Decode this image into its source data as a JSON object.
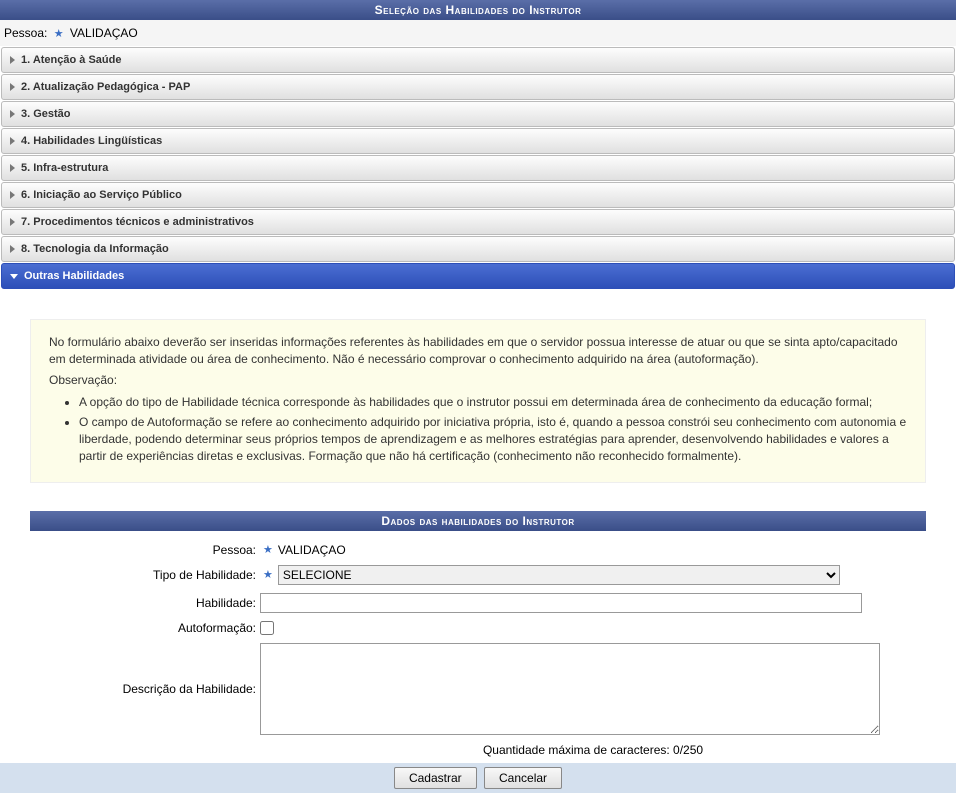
{
  "header": {
    "title": "Seleção das Habilidades do Instrutor"
  },
  "pessoa": {
    "label": "Pessoa:",
    "value": "VALIDAÇAO"
  },
  "accordion": {
    "items": [
      {
        "label": "1. Atenção à Saúde"
      },
      {
        "label": "2. Atualização Pedagógica - PAP"
      },
      {
        "label": "3. Gestão"
      },
      {
        "label": "4. Habilidades Lingüísticas"
      },
      {
        "label": "5. Infra-estrutura"
      },
      {
        "label": "6. Iniciação ao Serviço Público"
      },
      {
        "label": "7. Procedimentos técnicos e administrativos"
      },
      {
        "label": "8. Tecnologia da Informação"
      }
    ],
    "active": {
      "label": "Outras Habilidades"
    }
  },
  "info": {
    "paragraph": "No formulário abaixo deverão ser inseridas informações referentes às habilidades em que o servidor possua interesse de atuar ou que se sinta apto/capacitado em determinada atividade ou área de conhecimento. Não é necessário comprovar o conhecimento adquirido na área (autoformação).",
    "observacao_label": "Observação:",
    "bullets": [
      "A opção do tipo de Habilidade técnica corresponde às habilidades que o instrutor possui em determinada área de conhecimento da educação formal;",
      "O campo de Autoformação se refere ao conhecimento adquirido por iniciativa própria, isto é, quando a pessoa constrói seu conhecimento com autonomia e liberdade, podendo determinar seus próprios tempos de aprendizagem e as melhores estratégias para aprender, desenvolvendo habilidades e valores a partir de experiências diretas e exclusivas. Formação que não há certificação (conhecimento não reconhecido formalmente)."
    ]
  },
  "form": {
    "section_header": "Dados das habilidades do Instrutor",
    "pessoa_label": "Pessoa:",
    "pessoa_value": "VALIDAÇAO",
    "tipo_label": "Tipo de Habilidade:",
    "tipo_selected": "SELECIONE",
    "habilidade_label": "Habilidade:",
    "habilidade_value": "",
    "autoformacao_label": "Autoformação:",
    "descricao_label": "Descrição da Habilidade:",
    "descricao_value": "",
    "char_count": "Quantidade máxima de caracteres: 0/250",
    "button_submit": "Cadastrar",
    "button_cancel": "Cancelar"
  }
}
